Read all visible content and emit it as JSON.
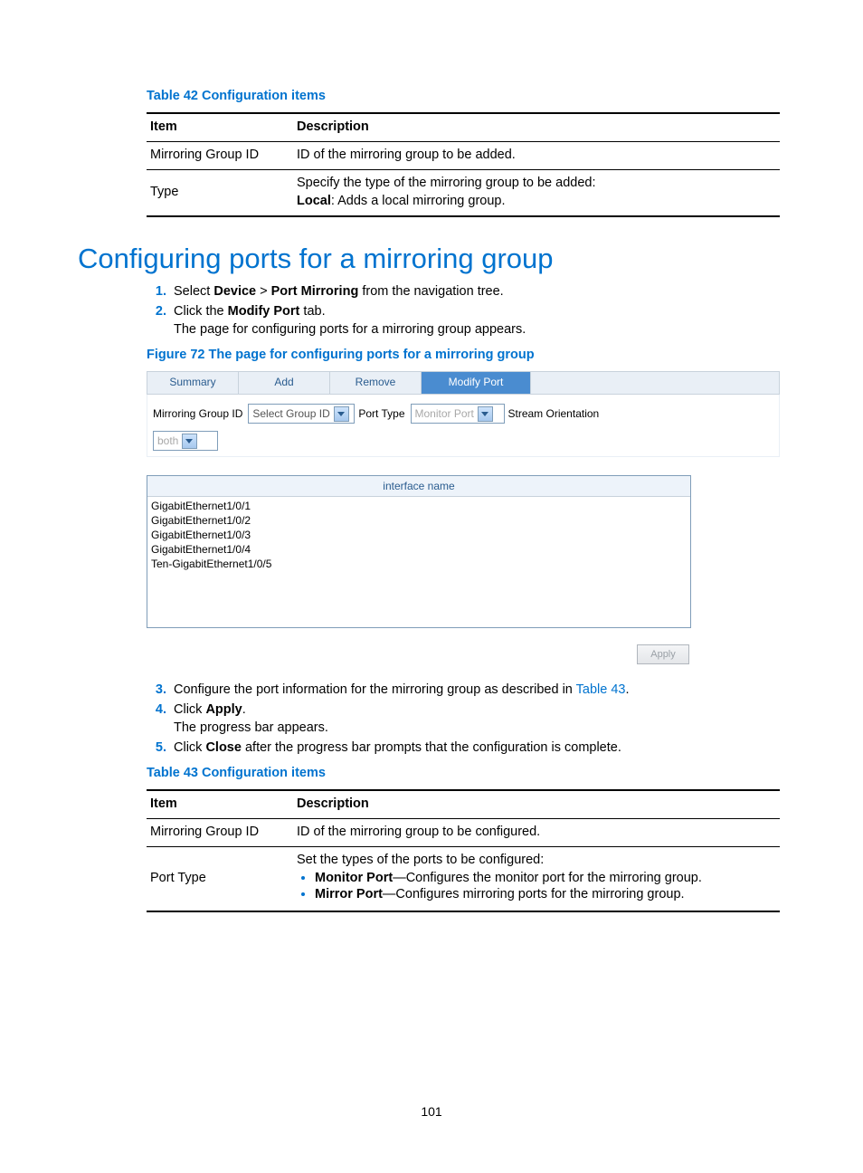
{
  "pageNumber": "101",
  "table42": {
    "caption": "Table 42 Configuration items",
    "headers": {
      "item": "Item",
      "desc": "Description"
    },
    "rows": [
      {
        "item": "Mirroring Group ID",
        "desc": "ID of the mirroring group to be added."
      },
      {
        "item": "Type",
        "desc_line1": "Specify the type of the mirroring group to be added:",
        "desc_bold": "Local",
        "desc_rest": ": Adds a local mirroring group."
      }
    ]
  },
  "sectionHeading": "Configuring ports for a mirroring group",
  "stepsA": {
    "s1_pre": "Select ",
    "s1_b1": "Device",
    "s1_mid": " > ",
    "s1_b2": "Port Mirroring",
    "s1_post": " from the navigation tree.",
    "s2_pre": "Click the ",
    "s2_b": "Modify Port",
    "s2_post": " tab.",
    "s2_extra": "The page for configuring ports for a mirroring group appears."
  },
  "figureCaption": "Figure 72 The page for configuring ports for a mirroring group",
  "tabs": {
    "summary": "Summary",
    "add": "Add",
    "remove": "Remove",
    "modify": "Modify Port"
  },
  "ctl": {
    "mgid_label": "Mirroring Group ID",
    "mgid_value": "Select Group ID",
    "pt_label": "Port Type",
    "pt_value": "Monitor Port",
    "so_label": "Stream Orientation",
    "so_value": "both"
  },
  "iface": {
    "header": "interface name",
    "items": [
      "GigabitEthernet1/0/1",
      "GigabitEthernet1/0/2",
      "GigabitEthernet1/0/3",
      "GigabitEthernet1/0/4",
      "Ten-GigabitEthernet1/0/5"
    ]
  },
  "applyLabel": "Apply",
  "stepsB": {
    "s3_pre": "Configure the port information for the mirroring group as described in ",
    "s3_link": "Table 43",
    "s3_post": ".",
    "s4_pre": "Click ",
    "s4_b": "Apply",
    "s4_post": ".",
    "s4_extra": "The progress bar appears.",
    "s5_pre": "Click ",
    "s5_b": "Close",
    "s5_post": " after the progress bar prompts that the configuration is complete."
  },
  "table43": {
    "caption": "Table 43 Configuration items",
    "headers": {
      "item": "Item",
      "desc": "Description"
    },
    "rows": {
      "r1": {
        "item": "Mirroring Group ID",
        "desc": "ID of the mirroring group to be configured."
      },
      "r2": {
        "item": "Port Type",
        "intro": "Set the types of the ports to be configured:",
        "b1_b": "Monitor Port",
        "b1_r": "—Configures the monitor port for the mirroring group.",
        "b2_b": "Mirror Port",
        "b2_r": "—Configures mirroring ports for the mirroring group."
      }
    }
  }
}
